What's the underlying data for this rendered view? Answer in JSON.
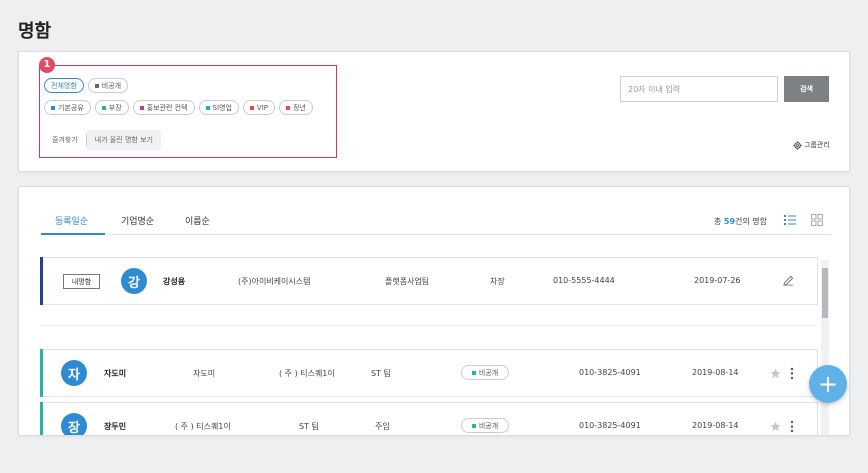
{
  "page": {
    "title": "명함"
  },
  "filter": {
    "marker": "1",
    "chips_row1": [
      {
        "label": "전체명함",
        "active": true,
        "color": ""
      },
      {
        "label": "비공개",
        "active": false,
        "color": "#666666"
      }
    ],
    "chips_row2": [
      {
        "label": "기본공유",
        "color": "#2f8bd1"
      },
      {
        "label": "부장",
        "color": "#29b3a4"
      },
      {
        "label": "홍보관련 컨텍",
        "color": "#c0399d"
      },
      {
        "label": "SI영업",
        "color": "#29b3a4"
      },
      {
        "label": "VIP",
        "color": "#e14a4a"
      },
      {
        "label": "정년",
        "color": "#e14a69"
      }
    ],
    "quick": {
      "favorites": "즐겨찾기",
      "my_uploaded": "내가 올린 명함 보기"
    },
    "search": {
      "placeholder": "20자 이내 입력",
      "button": "검색"
    },
    "group_manage": "그룹관리"
  },
  "list": {
    "tabs": [
      "등록일순",
      "기업명순",
      "이름순"
    ],
    "total_prefix": "총 ",
    "total_count": "59",
    "total_suffix": "건의 명함",
    "mycard": {
      "badge": "내명함",
      "avatar": "강",
      "name": "강성용",
      "company": "(주)아이비케이시스템",
      "dept": "플랫폼사업팀",
      "title": "차장",
      "phone": "010-5555-4444",
      "date": "2019-07-26",
      "bar_color": "#2a3c9a"
    },
    "rows": [
      {
        "avatar": "자",
        "name": "자도미",
        "col2": "자도미",
        "col3": "( 주 ) 티스퀘1이",
        "col4": "ST 팀",
        "badge": "비공개",
        "phone": "010-3825-4091",
        "date": "2019-08-14",
        "bar_color": "#29b3a4"
      },
      {
        "avatar": "장",
        "name": "장두민",
        "col2": "( 주 ) 티스퀘1이",
        "col3": "ST 팀",
        "col4": "주임",
        "badge": "비공개",
        "phone": "010-3825-4091",
        "date": "2019-08-14",
        "bar_color": "#29b3a4"
      }
    ],
    "fab": "+"
  },
  "colors": {
    "accent": "#2f8bd1",
    "marker": "#e14a69",
    "fab": "#5eb2e8"
  },
  "icons": [
    "gear-icon",
    "pencil-icon",
    "star-icon",
    "more-vertical-icon",
    "list-view-icon",
    "grid-view-icon",
    "plus-icon"
  ]
}
